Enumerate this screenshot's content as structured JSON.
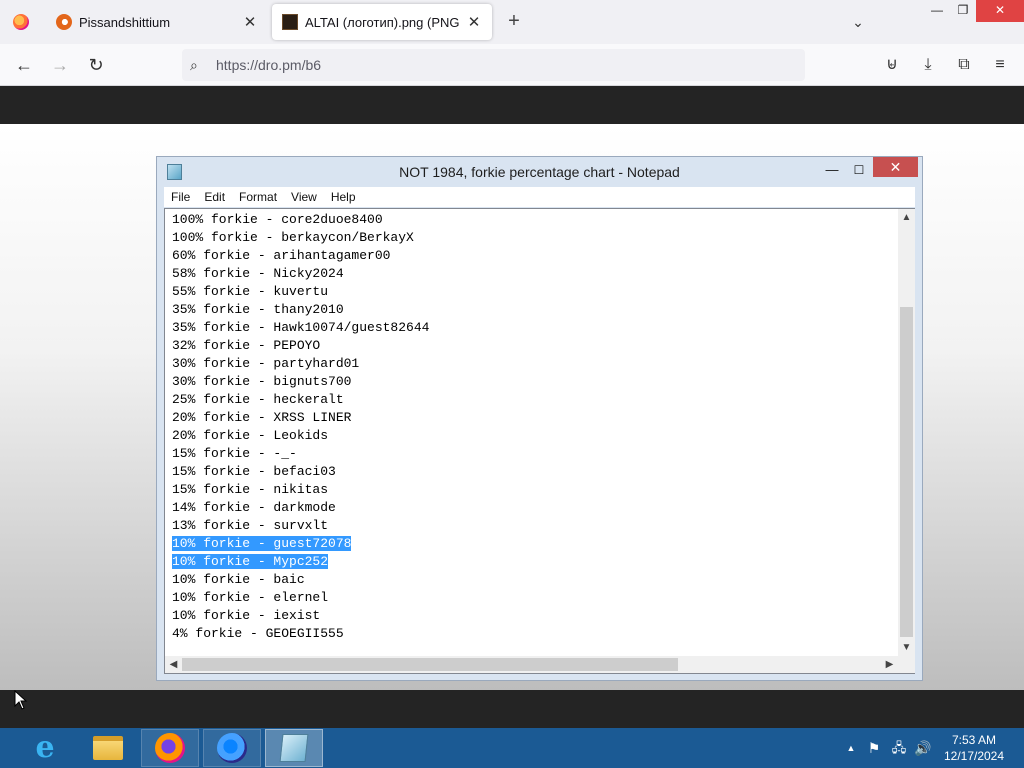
{
  "browser": {
    "tabs": [
      {
        "title": "Pissandshittium",
        "close": "✕"
      },
      {
        "title": "ALTAI (логотип).png (PNG Ima",
        "close": "✕"
      }
    ],
    "new_tab": "+",
    "tab_list": "⌄",
    "window_controls": {
      "minimize": "—",
      "maximize": "❐",
      "close": "✕"
    },
    "nav": {
      "back": "←",
      "forward": "→",
      "reload": "↻"
    },
    "url": {
      "search_icon": "⌕",
      "text": "https://dro.pm/b6"
    },
    "toolbar": {
      "pocket": "⊌",
      "download": "⤓",
      "extensions": "⧉",
      "menu": "≡"
    }
  },
  "notepad": {
    "title": "NOT 1984, forkie percentage chart - Notepad",
    "controls": {
      "minimize": "—",
      "maximize": "☐",
      "close": "✕"
    },
    "menu": [
      "File",
      "Edit",
      "Format",
      "View",
      "Help"
    ],
    "lines": [
      "100% forkie - core2duoe8400",
      "100% forkie - berkaycon/BerkayX",
      "60% forkie - arihantagamer00",
      "58% forkie - Nicky2024",
      "55% forkie - kuvertu",
      "35% forkie - thany2010",
      "35% forkie - Hawk10074/guest82644",
      "32% forkie - PEPOYO",
      "30% forkie - partyhard01",
      "30% forkie - bignuts700",
      "25% forkie - heckeralt",
      "20% forkie - XRSS LINER",
      "20% forkie - Leokids",
      "15% forkie - -_-",
      "15% forkie - befaci03",
      "15% forkie - nikitas",
      "14% forkie - darkmode",
      "13% forkie - survxlt",
      "10% forkie - guest72078",
      "10% forkie - Mypc252",
      "10% forkie - baic",
      "10% forkie - elernel",
      "10% forkie - iexist",
      "4% forkie - GEOEGII555"
    ],
    "selected_lines": [
      18,
      19
    ],
    "scroll": {
      "up": "▲",
      "down": "▼",
      "left": "◀",
      "right": "▶"
    }
  },
  "taskbar": {
    "apps": [
      "internet-explorer-icon",
      "file-explorer-icon",
      "firefox-icon",
      "firefox-nightly-icon",
      "notepad-icon"
    ],
    "ie_glyph": "e",
    "tray": {
      "arrow": "▲",
      "flag": "⚑",
      "network": "🖧",
      "volume": "🔊"
    },
    "clock": {
      "time": "7:53 AM",
      "date": "12/17/2024"
    }
  },
  "colors": {
    "selection": "#3399ff",
    "taskbar": "#1b5a94",
    "notepad_close": "#c75050"
  }
}
